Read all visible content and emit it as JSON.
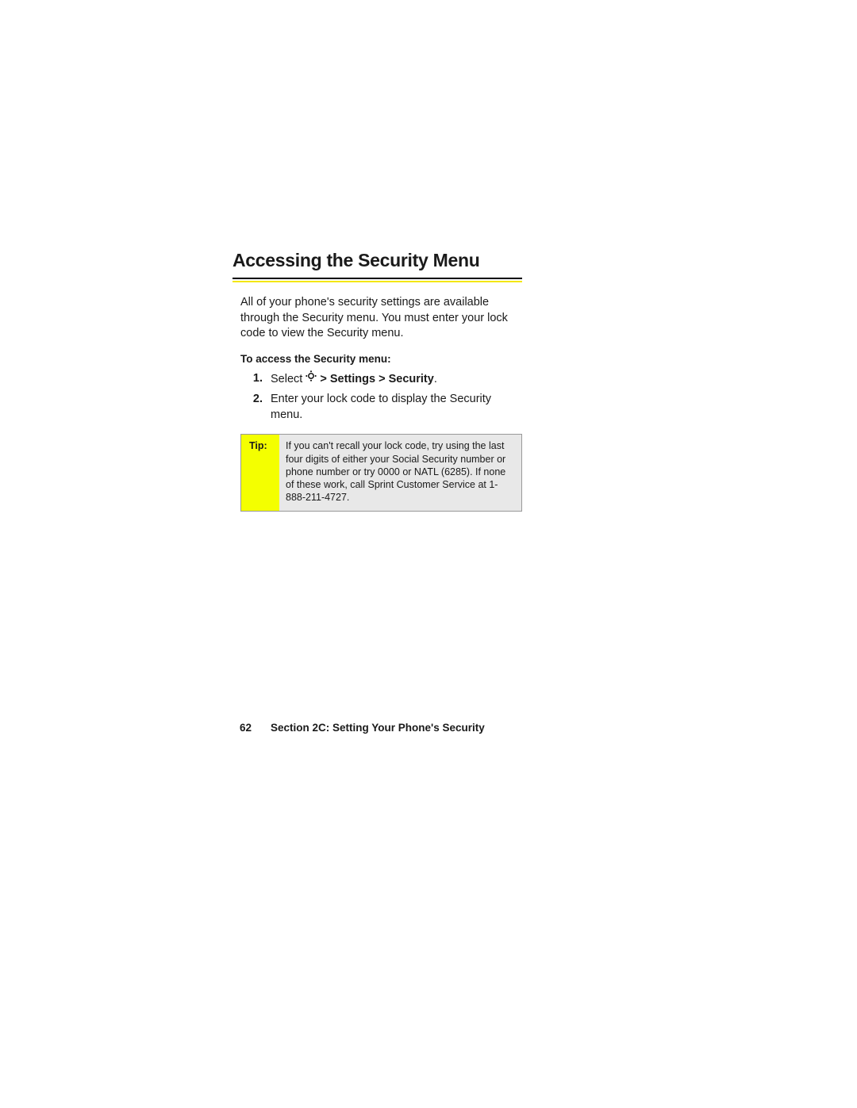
{
  "heading": "Accessing the Security Menu",
  "intro": "All of your phone's security settings are available through the Security menu. You must enter your lock code to view the Security menu.",
  "subhead": "To access the Security menu:",
  "steps": [
    {
      "num": "1.",
      "prefix": "Select ",
      "bold": " > Settings > Security",
      "suffix": "."
    },
    {
      "num": "2.",
      "text": "Enter your lock code to display the Security menu."
    }
  ],
  "tip": {
    "label": "Tip:",
    "body": "If you can't recall your lock code, try using the last four digits of either your Social Security number or phone number or try 0000 or NATL (6285). If none of these work, call Sprint Customer Service at 1-888-211-4727."
  },
  "footer": {
    "page": "62",
    "section": "Section 2C: Setting Your Phone's Security"
  }
}
